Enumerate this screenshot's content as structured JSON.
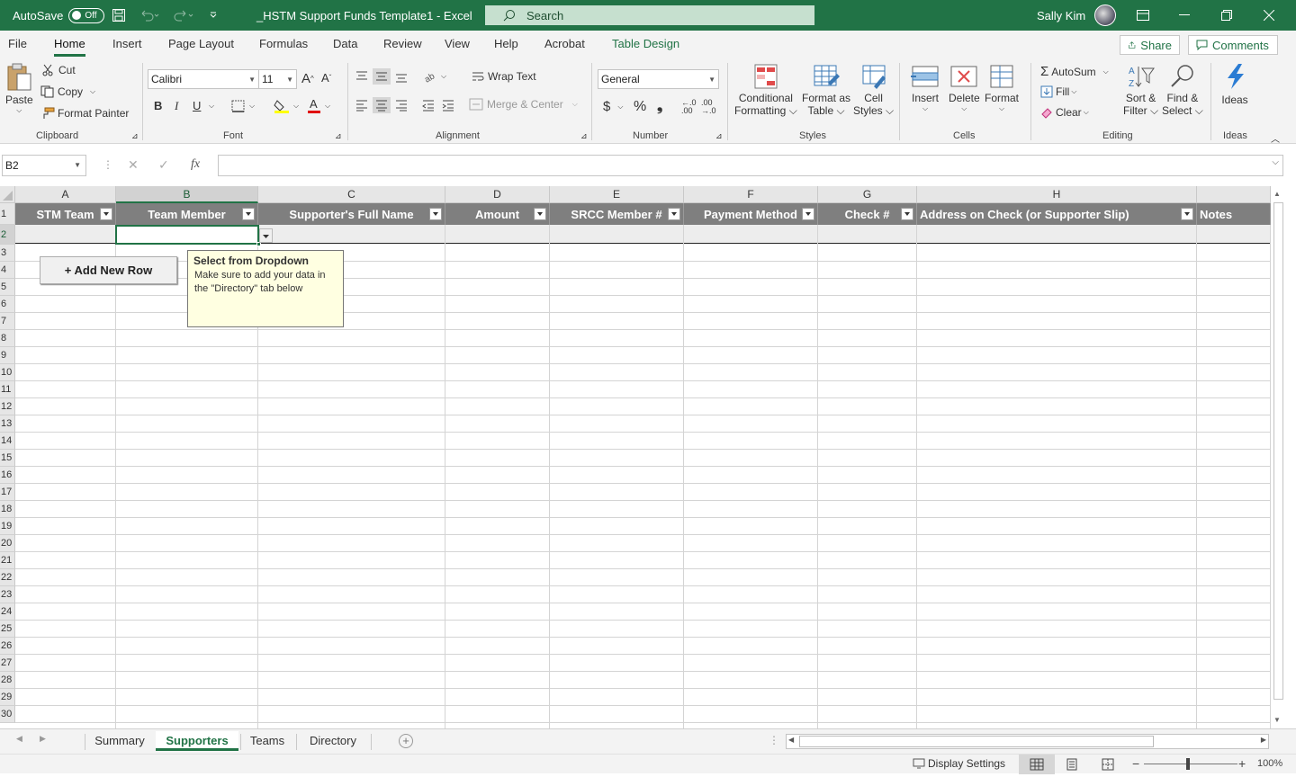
{
  "titlebar": {
    "autosave_label": "AutoSave",
    "autosave_state": "Off",
    "filename": "_HSTM Support Funds Template1",
    "separator": "-",
    "app": "Excel",
    "search_placeholder": "Search",
    "user": "Sally Kim"
  },
  "menu": {
    "tabs": [
      "File",
      "Home",
      "Insert",
      "Page Layout",
      "Formulas",
      "Data",
      "Review",
      "View",
      "Help",
      "Acrobat",
      "Table Design"
    ],
    "active": "Home",
    "share": "Share",
    "comments": "Comments"
  },
  "ribbon": {
    "clipboard": {
      "paste": "Paste",
      "cut": "Cut",
      "copy": "Copy",
      "format_painter": "Format Painter",
      "label": "Clipboard"
    },
    "font": {
      "name": "Calibri",
      "size": "11",
      "bold": "B",
      "italic": "I",
      "underline": "U",
      "label": "Font"
    },
    "alignment": {
      "wrap": "Wrap Text",
      "merge": "Merge & Center",
      "label": "Alignment"
    },
    "number": {
      "format": "General",
      "label": "Number"
    },
    "styles": {
      "conditional": "Conditional",
      "conditional2": "Formatting",
      "format_as": "Format as",
      "format_as2": "Table",
      "cell": "Cell",
      "cell2": "Styles",
      "label": "Styles"
    },
    "cells": {
      "insert": "Insert",
      "delete": "Delete",
      "format": "Format",
      "label": "Cells"
    },
    "editing": {
      "autosum": "AutoSum",
      "fill": "Fill",
      "clear": "Clear",
      "sort": "Sort &",
      "sort2": "Filter",
      "find": "Find &",
      "find2": "Select",
      "label": "Editing"
    },
    "ideas": {
      "label_btn": "Ideas",
      "label": "Ideas"
    }
  },
  "formula": {
    "namebox": "B2",
    "fx": "fx",
    "value": ""
  },
  "columns": [
    "A",
    "B",
    "C",
    "D",
    "E",
    "F",
    "G",
    "H"
  ],
  "selected_column": "B",
  "table_headers": [
    "STM Team",
    "Team Member",
    "Supporter's Full Name",
    "Amount",
    "SRCC Member #",
    "Payment Method",
    "Check #",
    "Address on Check (or Supporter Slip)",
    "Notes"
  ],
  "row_numbers": [
    "1",
    "2",
    "3",
    "4",
    "5",
    "6",
    "7",
    "8",
    "9",
    "10",
    "11",
    "12",
    "13",
    "14",
    "15",
    "16",
    "17",
    "18",
    "19",
    "20",
    "21",
    "22",
    "23",
    "24",
    "25",
    "26",
    "27",
    "28",
    "29",
    "30"
  ],
  "add_row_button": "+ Add New Row",
  "tooltip": {
    "title": "Select from Dropdown",
    "body": "Make sure to add your data in the \"Directory\" tab below"
  },
  "sheets": [
    "Summary",
    "Supporters",
    "Teams",
    "Directory"
  ],
  "active_sheet": "Supporters",
  "status": {
    "display_settings": "Display Settings",
    "zoom": "100%"
  },
  "colors": {
    "excel_green": "#217346",
    "table_header": "#7f7f7f",
    "tooltip_bg": "#ffffe1"
  }
}
